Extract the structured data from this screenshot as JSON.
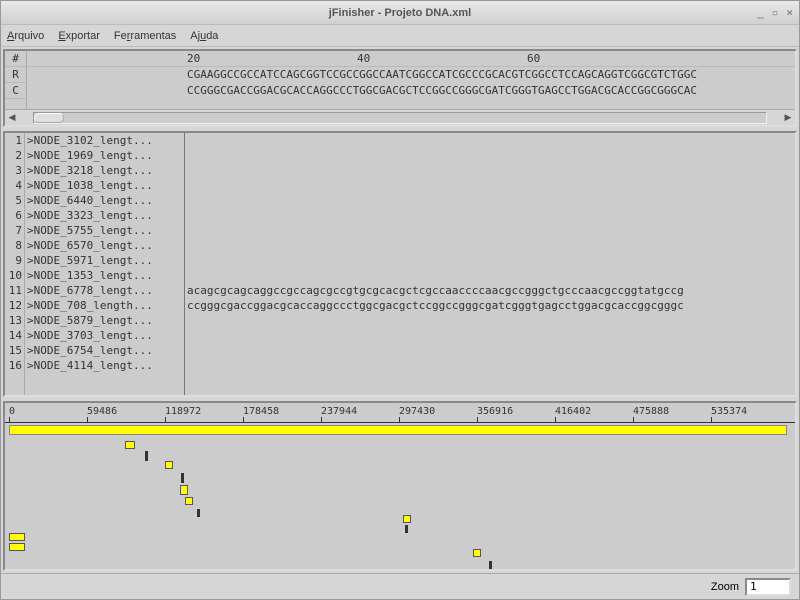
{
  "window": {
    "title": "jFinisher - Projeto DNA.xml"
  },
  "menu": {
    "arquivo": "Arquivo",
    "exportar": "Exportar",
    "ferramentas": "Ferramentas",
    "ajuda": "Ajuda"
  },
  "top_rows": {
    "hash": "#",
    "r": "R",
    "c": "C"
  },
  "ruler": {
    "t20": "20",
    "t40": "40",
    "t60": "60"
  },
  "seq_r": "CGAAGGCCGCCATCCAGCGGTCCGCCGGCCAATCGGCCATCGCCCGCACGTCGGCCTCCAGCAGGTCGGCGTCTGGC",
  "seq_c": "CCGGGCGACCGGACGCACCAGGCCCTGGCGACGCTCCGGCCGGGCGATCGGGTGAGCCTGGACGCACCGGCGGGCAC",
  "nodes": [
    ">NODE_3102_lengt...",
    ">NODE_1969_lengt...",
    ">NODE_3218_lengt...",
    ">NODE_1038_lengt...",
    ">NODE_6440_lengt...",
    ">NODE_3323_lengt...",
    ">NODE_5755_lengt...",
    ">NODE_6570_lengt...",
    ">NODE_5971_lengt...",
    ">NODE_1353_lengt...",
    ">NODE_6778_lengt...",
    ">NODE_708_length...",
    ">NODE_5879_lengt...",
    ">NODE_3703_lengt...",
    ">NODE_6754_lengt...",
    ">NODE_4114_lengt..."
  ],
  "seq_row_11": "acagcgcagcaggccgccagcgccgtgcgcacgctcgccaaccccaacgccgggctgcccaacgccggtatgccg",
  "seq_row_12": "ccgggcgaccggacgcaccaggccctggcgacgctccggccgggcgatcgggtgagcctggacgcaccggcgggc",
  "axis": {
    "t0": "0",
    "t1": "59486",
    "t2": "118972",
    "t3": "178458",
    "t4": "237944",
    "t5": "297430",
    "t6": "356916",
    "t7": "416402",
    "t8": "475888",
    "t9": "535374"
  },
  "status": {
    "zoom_label": "Zoom",
    "zoom_value": "1"
  }
}
